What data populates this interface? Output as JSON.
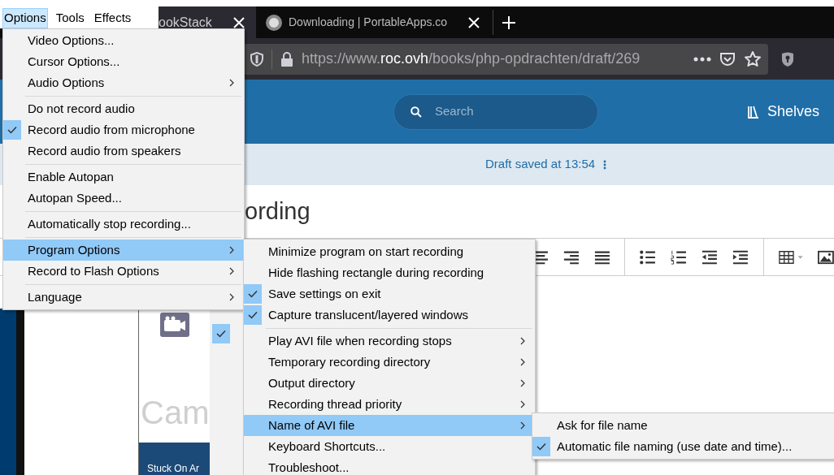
{
  "browser": {
    "tabs": [
      {
        "title": "ookStack",
        "selected": true
      },
      {
        "title": "Downloading | PortableApps.co",
        "selected": false
      }
    ],
    "url": "https://www.**roc.ovh**/books/php-opdrachten/draft/269"
  },
  "page": {
    "search_placeholder": "Search",
    "shelves": "Shelves",
    "draft_status": "Draft saved at 13:54",
    "heading": "ording"
  },
  "camstudio": {
    "title_fragment": "Cam",
    "status_fragment": "Stuck On Ar"
  },
  "menubar": [
    {
      "label": "Options",
      "selected": true
    },
    {
      "label": "Tools",
      "selected": false
    },
    {
      "label": "Effects",
      "selected": false
    }
  ],
  "menus": [
    {
      "items": [
        {
          "kind": "item",
          "label": "Video Options...",
          "checked": false,
          "selected": false,
          "submenu": false
        },
        {
          "kind": "item",
          "label": "Cursor Options...",
          "checked": false,
          "selected": false,
          "submenu": false
        },
        {
          "kind": "item",
          "label": "Audio Options",
          "checked": false,
          "selected": false,
          "submenu": true
        },
        {
          "kind": "separator"
        },
        {
          "kind": "item",
          "label": "Do not record audio",
          "checked": false,
          "selected": false,
          "submenu": false
        },
        {
          "kind": "item",
          "label": "Record audio from microphone",
          "checked": true,
          "selected": false,
          "submenu": false
        },
        {
          "kind": "item",
          "label": "Record audio from speakers",
          "checked": false,
          "selected": false,
          "submenu": false
        },
        {
          "kind": "separator"
        },
        {
          "kind": "item",
          "label": "Enable Autopan",
          "checked": false,
          "selected": false,
          "submenu": false
        },
        {
          "kind": "item",
          "label": "Autopan Speed...",
          "checked": false,
          "selected": false,
          "submenu": false
        },
        {
          "kind": "separator"
        },
        {
          "kind": "item",
          "label": "Automatically stop recording...",
          "checked": false,
          "selected": false,
          "submenu": false
        },
        {
          "kind": "separator"
        },
        {
          "kind": "item",
          "label": "Program Options",
          "checked": false,
          "selected": true,
          "submenu": true
        },
        {
          "kind": "item",
          "label": "Record to Flash Options",
          "checked": false,
          "selected": false,
          "submenu": true
        },
        {
          "kind": "separator"
        },
        {
          "kind": "item",
          "label": "Language",
          "checked": false,
          "selected": false,
          "submenu": true
        }
      ]
    },
    {
      "items": [
        {
          "kind": "item",
          "label": "Minimize program on start recording",
          "checked": false,
          "selected": false,
          "submenu": false
        },
        {
          "kind": "item",
          "label": "Hide flashing rectangle during recording",
          "checked": false,
          "selected": false,
          "submenu": false
        },
        {
          "kind": "item",
          "label": "Save settings on exit",
          "checked": true,
          "selected": false,
          "submenu": false
        },
        {
          "kind": "item",
          "label": "Capture translucent/layered windows",
          "checked": true,
          "selected": false,
          "submenu": false
        },
        {
          "kind": "separator"
        },
        {
          "kind": "item",
          "label": "Play AVI file when recording stops",
          "checked": false,
          "selected": false,
          "submenu": true
        },
        {
          "kind": "item",
          "label": "Temporary recording directory",
          "checked": false,
          "selected": false,
          "submenu": true
        },
        {
          "kind": "item",
          "label": "Output directory",
          "checked": false,
          "selected": false,
          "submenu": true
        },
        {
          "kind": "item",
          "label": "Recording thread priority",
          "checked": false,
          "selected": false,
          "submenu": true
        },
        {
          "kind": "item",
          "label": "Name of AVI file",
          "checked": false,
          "selected": true,
          "submenu": true
        },
        {
          "kind": "item",
          "label": "Keyboard Shortcuts...",
          "checked": false,
          "selected": false,
          "submenu": false
        },
        {
          "kind": "item",
          "label": "Troubleshoot...",
          "checked": false,
          "selected": false,
          "submenu": false
        }
      ]
    },
    {
      "items": [
        {
          "kind": "item",
          "label": "Ask for file name",
          "checked": false,
          "selected": false,
          "submenu": false
        },
        {
          "kind": "item",
          "label": "Automatic file naming (use date and time)...",
          "checked": true,
          "selected": false,
          "submenu": false
        }
      ]
    }
  ]
}
